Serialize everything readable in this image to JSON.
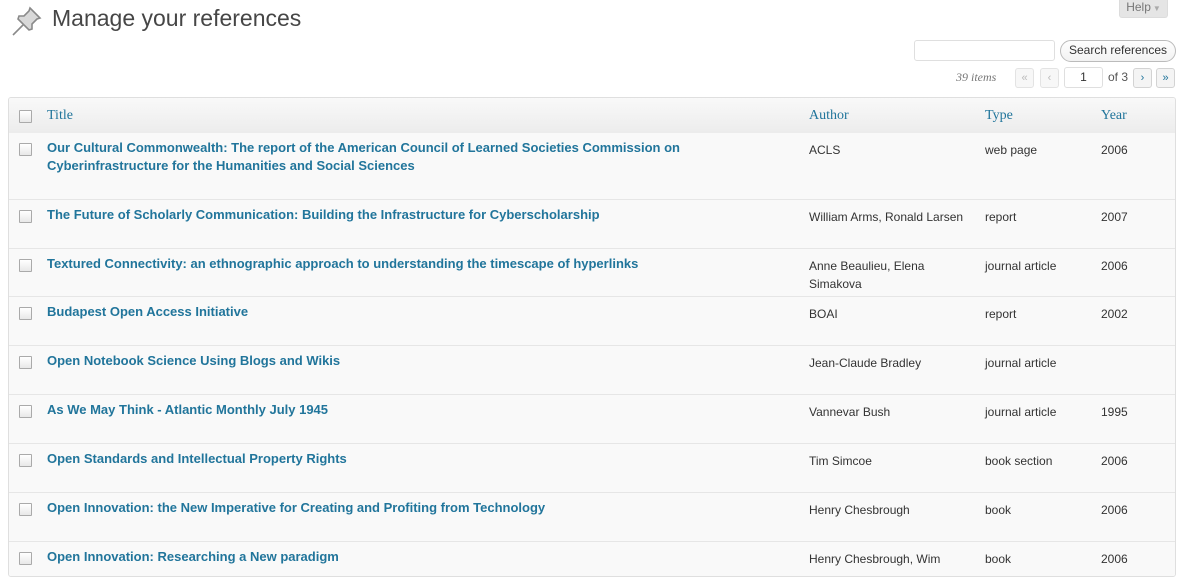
{
  "header": {
    "title": "Manage your references",
    "help_label": "Help"
  },
  "search": {
    "value": "",
    "button_label": "Search references"
  },
  "pagination": {
    "items_count": "39 items",
    "first": "«",
    "prev": "‹",
    "current_page": "1",
    "of_label": "of 3",
    "next": "›",
    "last": "»"
  },
  "table": {
    "columns": {
      "title": "Title",
      "author": "Author",
      "type": "Type",
      "year": "Year"
    },
    "rows": [
      {
        "title": "Our Cultural Commonwealth: The report of the American Council of Learned Societies Commission on Cyberinfrastructure for the Humanities and Social Sciences",
        "author": "ACLS",
        "type": "web page",
        "year": "2006"
      },
      {
        "title": "The Future of Scholarly Communication: Building the Infrastructure for Cyberscholarship",
        "author": "William Arms, Ronald Larsen",
        "type": "report",
        "year": "2007"
      },
      {
        "title": "Textured Connectivity: an ethnographic approach to understanding the timescape of hyperlinks",
        "author": "Anne Beaulieu, Elena Simakova",
        "type": "journal article",
        "year": "2006"
      },
      {
        "title": "Budapest Open Access Initiative",
        "author": "BOAI",
        "type": "report",
        "year": "2002"
      },
      {
        "title": "Open Notebook Science Using Blogs and Wikis",
        "author": "Jean-Claude Bradley",
        "type": "journal article",
        "year": ""
      },
      {
        "title": "As We May Think - Atlantic Monthly July 1945",
        "author": "Vannevar Bush",
        "type": "journal article",
        "year": "1995"
      },
      {
        "title": "Open Standards and Intellectual Property Rights",
        "author": "Tim Simcoe",
        "type": "book section",
        "year": "2006"
      },
      {
        "title": "Open Innovation: the New Imperative for Creating and Profiting from Technology",
        "author": "Henry Chesbrough",
        "type": "book",
        "year": "2006"
      },
      {
        "title": "Open Innovation: Researching a New paradigm",
        "author": "Henry Chesbrough, Wim",
        "type": "book",
        "year": "2006"
      }
    ]
  }
}
